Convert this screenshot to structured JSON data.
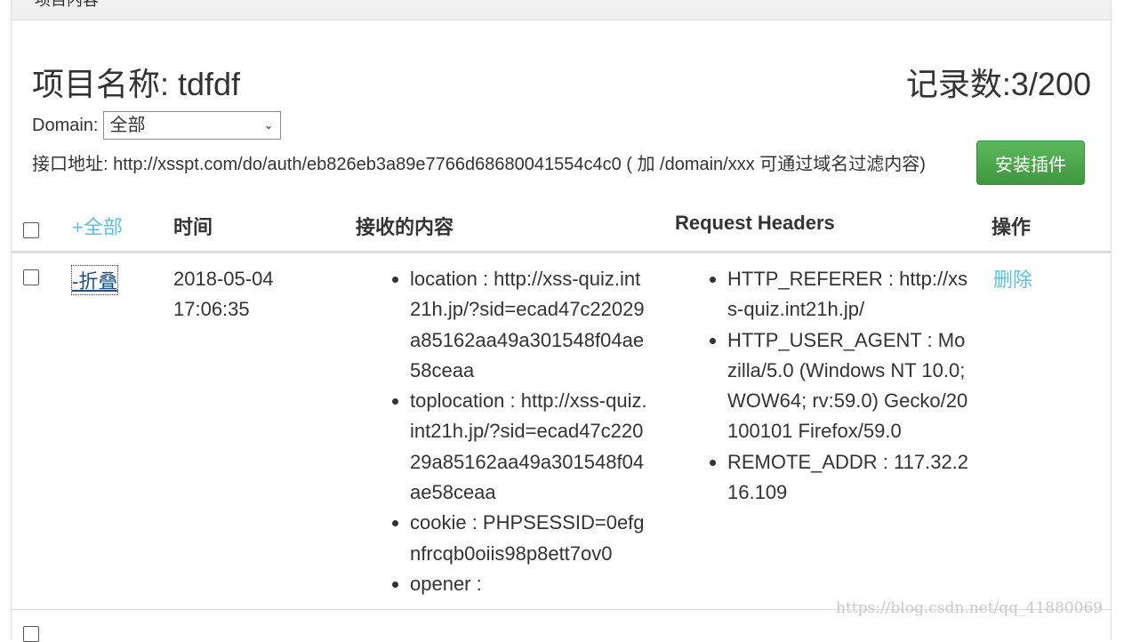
{
  "panel": {
    "heading": "项目内容"
  },
  "project": {
    "title": "项目名称: tdfdf",
    "record_count": "记录数:3/200"
  },
  "domain_filter": {
    "label": "Domain:",
    "selected": "全部"
  },
  "api": {
    "text": "接口地址: http://xsspt.com/do/auth/eb826eb3a89e7766d68680041554c4c0 ( 加 /domain/xxx 可通过域名过滤内容)"
  },
  "install_button": {
    "label": "安装插件"
  },
  "table": {
    "headers": {
      "expand_all": "+全部",
      "time": "时间",
      "content": "接收的内容",
      "request_headers": "Request Headers",
      "actions": "操作"
    },
    "rows": [
      {
        "toggle": "-折叠",
        "time": "2018-05-04 17:06:35",
        "content": [
          "location : http://xss-quiz.int21h.jp/?sid=ecad47c22029a85162aa49a301548f04ae58ceaa",
          "toplocation : http://xss-quiz.int21h.jp/?sid=ecad47c22029a85162aa49a301548f04ae58ceaa",
          "cookie : PHPSESSID=0efgnfrcqb0oiis98p8ett7ov0",
          "opener :"
        ],
        "headers": [
          "HTTP_REFERER : http://xss-quiz.int21h.jp/",
          "HTTP_USER_AGENT : Mozilla/5.0 (Windows NT 10.0; WOW64; rv:59.0) Gecko/20100101 Firefox/59.0",
          "REMOTE_ADDR : 117.32.216.109"
        ],
        "action": "删除"
      }
    ]
  },
  "watermark": "https://blog.csdn.net/qq_41880069"
}
